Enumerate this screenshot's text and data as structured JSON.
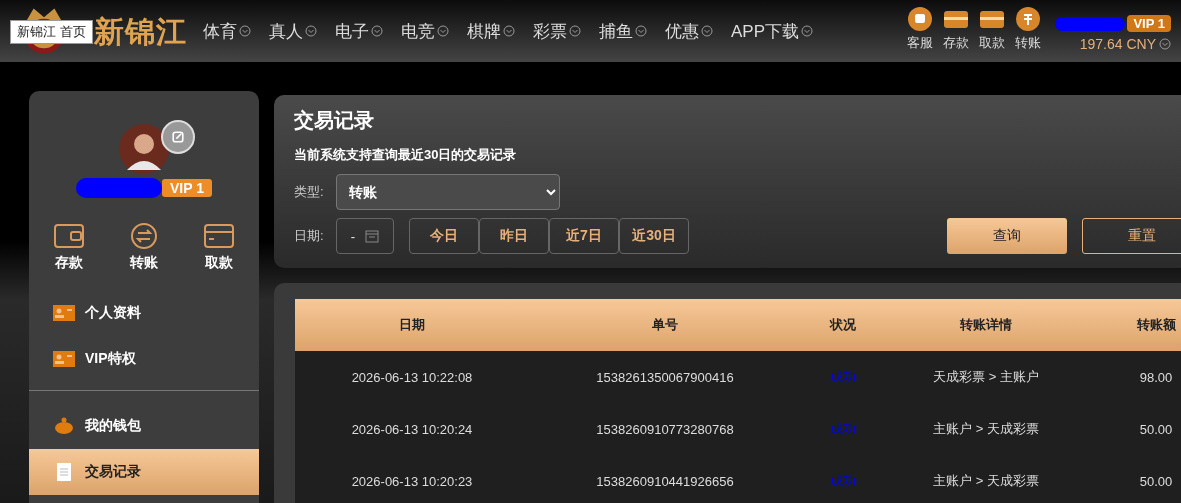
{
  "header": {
    "logo": "新锦江",
    "tooltip": "新锦江 首页",
    "nav": [
      {
        "label": "体育"
      },
      {
        "label": "真人"
      },
      {
        "label": "电子"
      },
      {
        "label": "电竞"
      },
      {
        "label": "棋牌"
      },
      {
        "label": "彩票"
      },
      {
        "label": "捕鱼"
      },
      {
        "label": "优惠"
      },
      {
        "label": "APP下载"
      }
    ],
    "actions": [
      {
        "kind": "chat",
        "label": "客服"
      },
      {
        "kind": "wallet",
        "label": "存款"
      },
      {
        "kind": "card",
        "label": "取款"
      },
      {
        "kind": "transfer",
        "label": "转账"
      }
    ],
    "vip": "VIP 1",
    "balance": "197.64 CNY"
  },
  "sidebar": {
    "vip": "VIP 1",
    "quick": [
      {
        "kind": "wallet",
        "label": "存款"
      },
      {
        "kind": "transfer",
        "label": "转账"
      },
      {
        "kind": "card",
        "label": "取款"
      }
    ],
    "menu": [
      {
        "kind": "id",
        "label": "个人资料",
        "selected": false
      },
      {
        "kind": "id",
        "label": "VIP特权",
        "selected": false
      },
      {
        "kind": "divider"
      },
      {
        "kind": "pig",
        "label": "我的钱包",
        "selected": false
      },
      {
        "kind": "doc",
        "label": "交易记录",
        "selected": true
      }
    ]
  },
  "filter": {
    "title": "交易记录",
    "note": "当前系统支持查询最近30日的交易记录",
    "type_label": "类型:",
    "type_value": "转账",
    "date_label": "日期:",
    "date_value": "-",
    "ranges": [
      {
        "label": "今日"
      },
      {
        "label": "昨日"
      },
      {
        "label": "近7日"
      },
      {
        "label": "近30日"
      }
    ],
    "query": "查询",
    "reset": "重置"
  },
  "table": {
    "columns": [
      "日期",
      "单号",
      "状况",
      "转账详情",
      "转账额"
    ],
    "rows": [
      {
        "date": "2026-06-13 10:22:08",
        "id": "1538261350067900416",
        "status": "成功",
        "detail": "天成彩票 > 主账户",
        "amount": "98.00"
      },
      {
        "date": "2026-06-13 10:20:24",
        "id": "1538260910773280768",
        "status": "成功",
        "detail": "主账户 > 天成彩票",
        "amount": "50.00"
      },
      {
        "date": "2026-06-13 10:20:23",
        "id": "1538260910441926656",
        "status": "成功",
        "detail": "主账户 > 天成彩票",
        "amount": "50.00"
      }
    ]
  }
}
